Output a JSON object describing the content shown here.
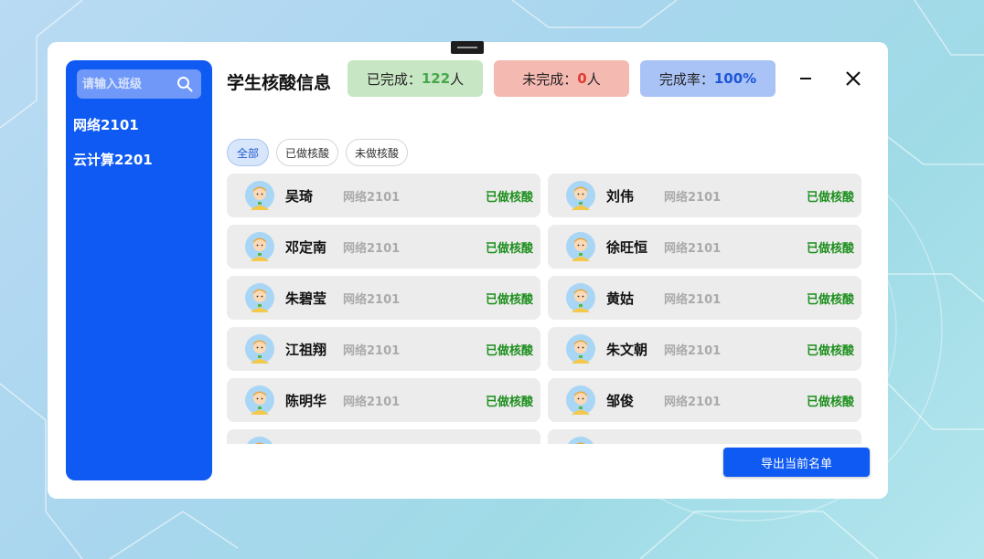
{
  "sidebar": {
    "search": {
      "placeholder": "请输入班级",
      "value": ""
    },
    "classes": [
      "网络2101",
      "云计算2201"
    ]
  },
  "header": {
    "title": "学生核酸信息",
    "done": {
      "label": "已完成：",
      "value": "122",
      "unit": "人"
    },
    "undone": {
      "label": "未完成：",
      "value": "0",
      "unit": "人"
    },
    "rate": {
      "label": "完成率：",
      "value": "100%"
    }
  },
  "filters": [
    "全部",
    "已做核酸",
    "未做核酸"
  ],
  "students": [
    {
      "name": "吴琦",
      "class": "网络2101",
      "status": "已做核酸"
    },
    {
      "name": "刘伟",
      "class": "网络2101",
      "status": "已做核酸"
    },
    {
      "name": "邓定南",
      "class": "网络2101",
      "status": "已做核酸"
    },
    {
      "name": "徐旺恒",
      "class": "网络2101",
      "status": "已做核酸"
    },
    {
      "name": "朱碧莹",
      "class": "网络2101",
      "status": "已做核酸"
    },
    {
      "name": "黄姑",
      "class": "网络2101",
      "status": "已做核酸"
    },
    {
      "name": "江祖翔",
      "class": "网络2101",
      "status": "已做核酸"
    },
    {
      "name": "朱文朝",
      "class": "网络2101",
      "status": "已做核酸"
    },
    {
      "name": "陈明华",
      "class": "网络2101",
      "status": "已做核酸"
    },
    {
      "name": "邹俊",
      "class": "网络2101",
      "status": "已做核酸"
    }
  ],
  "export_label": "导出当前名单",
  "colors": {
    "primary": "#0f5af2",
    "done_bg": "#c7e6c3",
    "undone_bg": "#f4b9b1",
    "rate_bg": "#a9c3f7",
    "status_green": "#1e8f1e"
  }
}
